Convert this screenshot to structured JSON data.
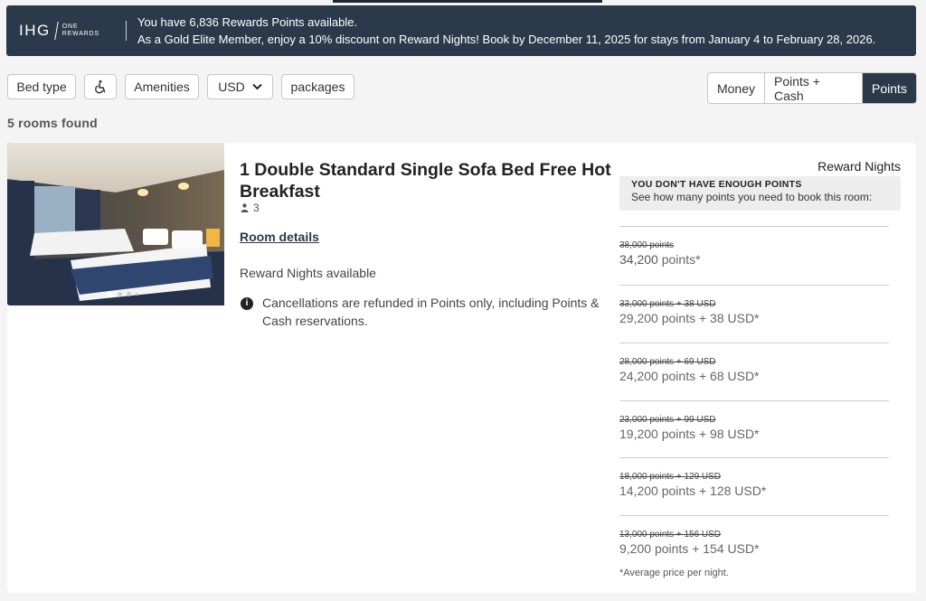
{
  "banner": {
    "logo_main": "IHG",
    "logo_sub1": "ONE",
    "logo_sub2": "REWARDS",
    "line1": "You have 6,836 Rewards Points available.",
    "line2": "As a Gold Elite Member, enjoy a 10% discount on Reward Nights! Book by December 11, 2025 for stays from January 4 to February 28, 2026."
  },
  "filters": {
    "bed_type": "Bed type",
    "accessible_icon": "wheelchair-icon",
    "amenities": "Amenities",
    "currency": "USD",
    "packages": "packages"
  },
  "payment_toggle": {
    "options": [
      "Money",
      "Points + Cash",
      "Points"
    ],
    "selected": "Points"
  },
  "results": {
    "count_label": "5 rooms found"
  },
  "room": {
    "title": "1 Double Standard Single Sofa Bed Free Hot Breakfast",
    "occupancy": "3",
    "details_link": "Room details",
    "availability": "Reward Nights available",
    "cancellation": "Cancellations are refunded in Points only, including Points & Cash reservations.",
    "rate_type": "Reward Nights",
    "warning_title": "YOU DON'T HAVE ENOUGH POINTS",
    "warning_sub": "See how many points you need to book this room:",
    "rates": [
      {
        "old": "38,000 points",
        "points": "34,200",
        "points_unit": "points*",
        "cash": "",
        "cash_unit": ""
      },
      {
        "old": "33,000 points + 38 USD",
        "points": "29,200",
        "points_unit": "points",
        "cash": "+ 38",
        "cash_unit": "USD*"
      },
      {
        "old": "28,000 points + 69 USD",
        "points": "24,200",
        "points_unit": "points",
        "cash": "+ 68",
        "cash_unit": "USD*"
      },
      {
        "old": "23,000 points + 99 USD",
        "points": "19,200",
        "points_unit": "points",
        "cash": "+ 98",
        "cash_unit": "USD*"
      },
      {
        "old": "18,000 points + 129 USD",
        "points": "14,200",
        "points_unit": "points",
        "cash": "+ 128",
        "cash_unit": "USD*"
      },
      {
        "old": "13,000 points + 156 USD",
        "points": "9,200",
        "points_unit": "points",
        "cash": "+ 154",
        "cash_unit": "USD*"
      }
    ],
    "footnote": "*Average price per night.",
    "carousel": {
      "count": 4,
      "active": 1
    }
  }
}
